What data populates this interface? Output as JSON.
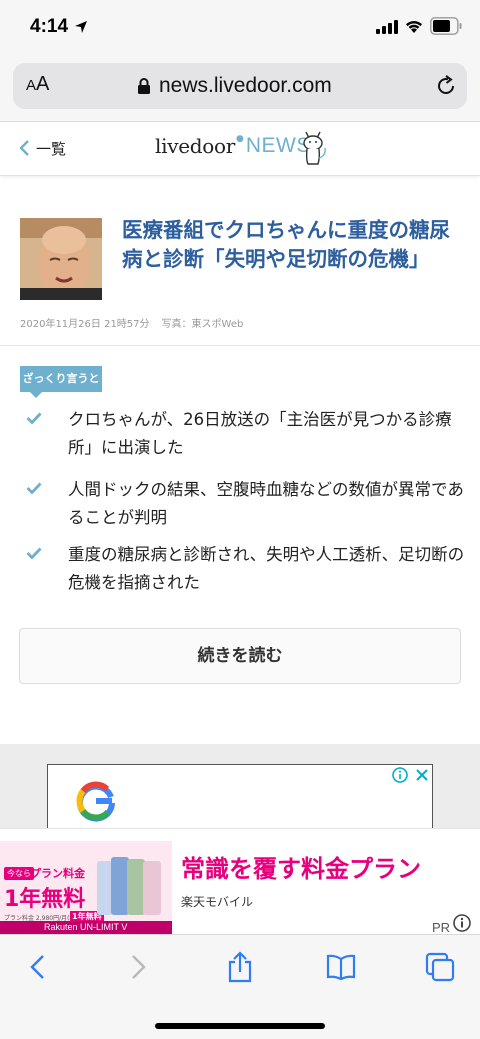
{
  "status_bar": {
    "time": "4:14"
  },
  "browser": {
    "text_size_button": {
      "small": "A",
      "large": "A"
    },
    "url": "news.livedoor.com"
  },
  "site_header": {
    "back_label": "一覧",
    "logo_livedoor": "livedoor",
    "logo_mark": "●",
    "logo_news": "NEWS"
  },
  "article": {
    "headline": "医療番組でクロちゃんに重度の糖尿病と診断「失明や足切断の危機」",
    "date": "2020年11月26日 21時57分",
    "photo_credit": "写真：東スポWeb"
  },
  "summary": {
    "tag": "ざっくり言うと",
    "items": [
      "クロちゃんが、26日放送の「主治医が見つかる診療所」に出演した",
      "人間ドックの結果、空腹時血糖などの数値が異常であることが判明",
      "重度の糖尿病と診断され、失明や人工透析、足切断の危機を指摘された"
    ]
  },
  "read_more_label": "続きを読む",
  "ad_banner": {
    "badge": "今なら",
    "plan": "プラン料金",
    "free": "1年無料",
    "fine_print": "プラン料金 2,980円/月(税抜)が",
    "fine_print_badge": "1年無料",
    "brand": "Rakuten UN-LIMIT V",
    "headline": "常識を覆す料金プラン",
    "sub": "楽天モバイル",
    "pr": "PR"
  },
  "colors": {
    "accent": "#6fb0cf",
    "headline": "#2d5e9e",
    "ad_pink": "#e6007e",
    "ios_blue": "#2f7cf6"
  }
}
